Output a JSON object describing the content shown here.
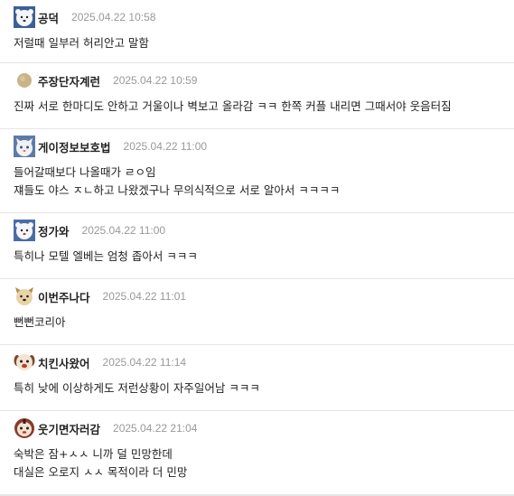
{
  "comments": [
    {
      "nickname": "공덕",
      "avatar": "polar-bear-avatar",
      "date": "2025.04.22 10:58",
      "lines": [
        "저럴때 일부러 허리안고 말함"
      ]
    },
    {
      "nickname": "주장단자계런",
      "avatar": "tan-dot-avatar",
      "date": "2025.04.22 10:59",
      "lines": [
        "진짜 서로 한마디도 안하고 거울이나 벽보고 올라감 ㅋㅋ 한쪽 커플 내리면 그때서야 웃음터짐"
      ]
    },
    {
      "nickname": "게이정보보호법",
      "avatar": "cat-avatar",
      "date": "2025.04.22 11:00",
      "lines": [
        "들어갈때보다 나올때가 ㄹㅇ임",
        "쟤들도 야스 ㅈㄴ하고 나왔겠구나 무의식적으로 서로 알아서 ㅋㅋㅋㅋ"
      ]
    },
    {
      "nickname": "정가와",
      "avatar": "polar-bear-avatar",
      "date": "2025.04.22 11:00",
      "lines": [
        "특히나 모텔 엘베는 엄청 좁아서 ㅋㅋㅋ"
      ]
    },
    {
      "nickname": "이번주나다",
      "avatar": "dog-avatar",
      "date": "2025.04.22 11:01",
      "lines": [
        "뻔뻔코리아"
      ]
    },
    {
      "nickname": "치킨사왔어",
      "avatar": "puppy-avatar",
      "date": "2025.04.22 11:14",
      "lines": [
        "특히 낮에 이상하게도 저런상황이 자주일어남 ㅋㅋㅋ"
      ]
    },
    {
      "nickname": "웃기면자러감",
      "avatar": "tiger-avatar",
      "date": "2025.04.22 21:04",
      "lines": [
        "숙박은 잠+ㅅㅅ 니까 덜 민망한데",
        "대실은 오로지 ㅅㅅ 목적이라 더 민망"
      ]
    }
  ],
  "colors": {
    "text": "#222222",
    "date": "#999999",
    "divider": "#e6e6e6"
  }
}
